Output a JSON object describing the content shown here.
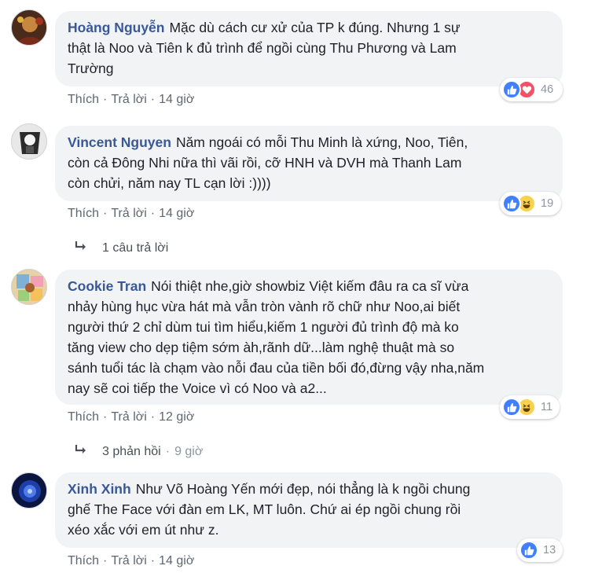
{
  "comments": [
    {
      "author": "Hoàng Nguyễn",
      "lines": [
        "Mặc dù cách cư xử của TP k đúng. Nhưng 1 sự",
        "thật là Noo và Tiên k đủ trình để ngồi cùng Thu Phương và Lam",
        "Trường"
      ],
      "like_label": "Thích",
      "reply_label": "Trả lời",
      "time": "14 giờ",
      "reaction_icons": [
        "like-icon",
        "love-icon"
      ],
      "reaction_count": "46"
    },
    {
      "author": "Vincent Nguyen",
      "lines": [
        "Năm ngoái có mỗi Thu Minh là xứng, Noo, Tiên,",
        "còn cả Đông Nhi nữa thì vãi rồi, cỡ HNH và DVH mà Thanh Lam",
        "còn chửi, năm nay TL cạn lời :))))"
      ],
      "like_label": "Thích",
      "reply_label": "Trả lời",
      "time": "14 giờ",
      "reaction_icons": [
        "like-icon",
        "haha-icon"
      ],
      "reaction_count": "19",
      "replies_text": "1 câu trả lời"
    },
    {
      "author": "Cookie Tran",
      "lines": [
        "Nói thiệt nhe,giờ showbiz Việt kiếm đâu ra ca sĩ vừa",
        "nhảy hùng hục vừa hát mà vẫn tròn vành rõ chữ như Noo,ai biết",
        "người thứ 2 chỉ dùm tui tìm hiểu,kiếm 1 người đủ trình độ mà ko",
        "tăng view cho dẹp tiệm sớm àh,rãnh dữ...làm nghệ thuật mà so",
        "sánh tuổi tác là chạm vào nỗi đau của tiền bối đó,đừng vậy nha,năm",
        "nay sẽ coi tiếp the Voice vì có Noo và a2..."
      ],
      "like_label": "Thích",
      "reply_label": "Trả lời",
      "time": "12 giờ",
      "reaction_icons": [
        "like-icon",
        "haha-icon"
      ],
      "reaction_count": "11",
      "replies_text": "3 phản hồi",
      "replies_time": "9 giờ"
    },
    {
      "author": "Xinh Xinh",
      "lines": [
        "Như Võ Hoàng Yến mới đẹp, nói thẳng là k ngồi chung",
        "ghế The Face với đàn em LK, MT luôn. Chứ ai ép ngồi chung rồi",
        "xéo xắc với em út như z."
      ],
      "like_label": "Thích",
      "reply_label": "Trả lời",
      "time": "14 giờ",
      "reaction_icons": [
        "like-icon"
      ],
      "reaction_count": "13"
    }
  ],
  "separator": "·",
  "colors": {
    "author": "#385898",
    "bubble": "#f2f3f5",
    "like": "#4080ff",
    "love": "#f25268",
    "haha": "#fbd04b"
  }
}
